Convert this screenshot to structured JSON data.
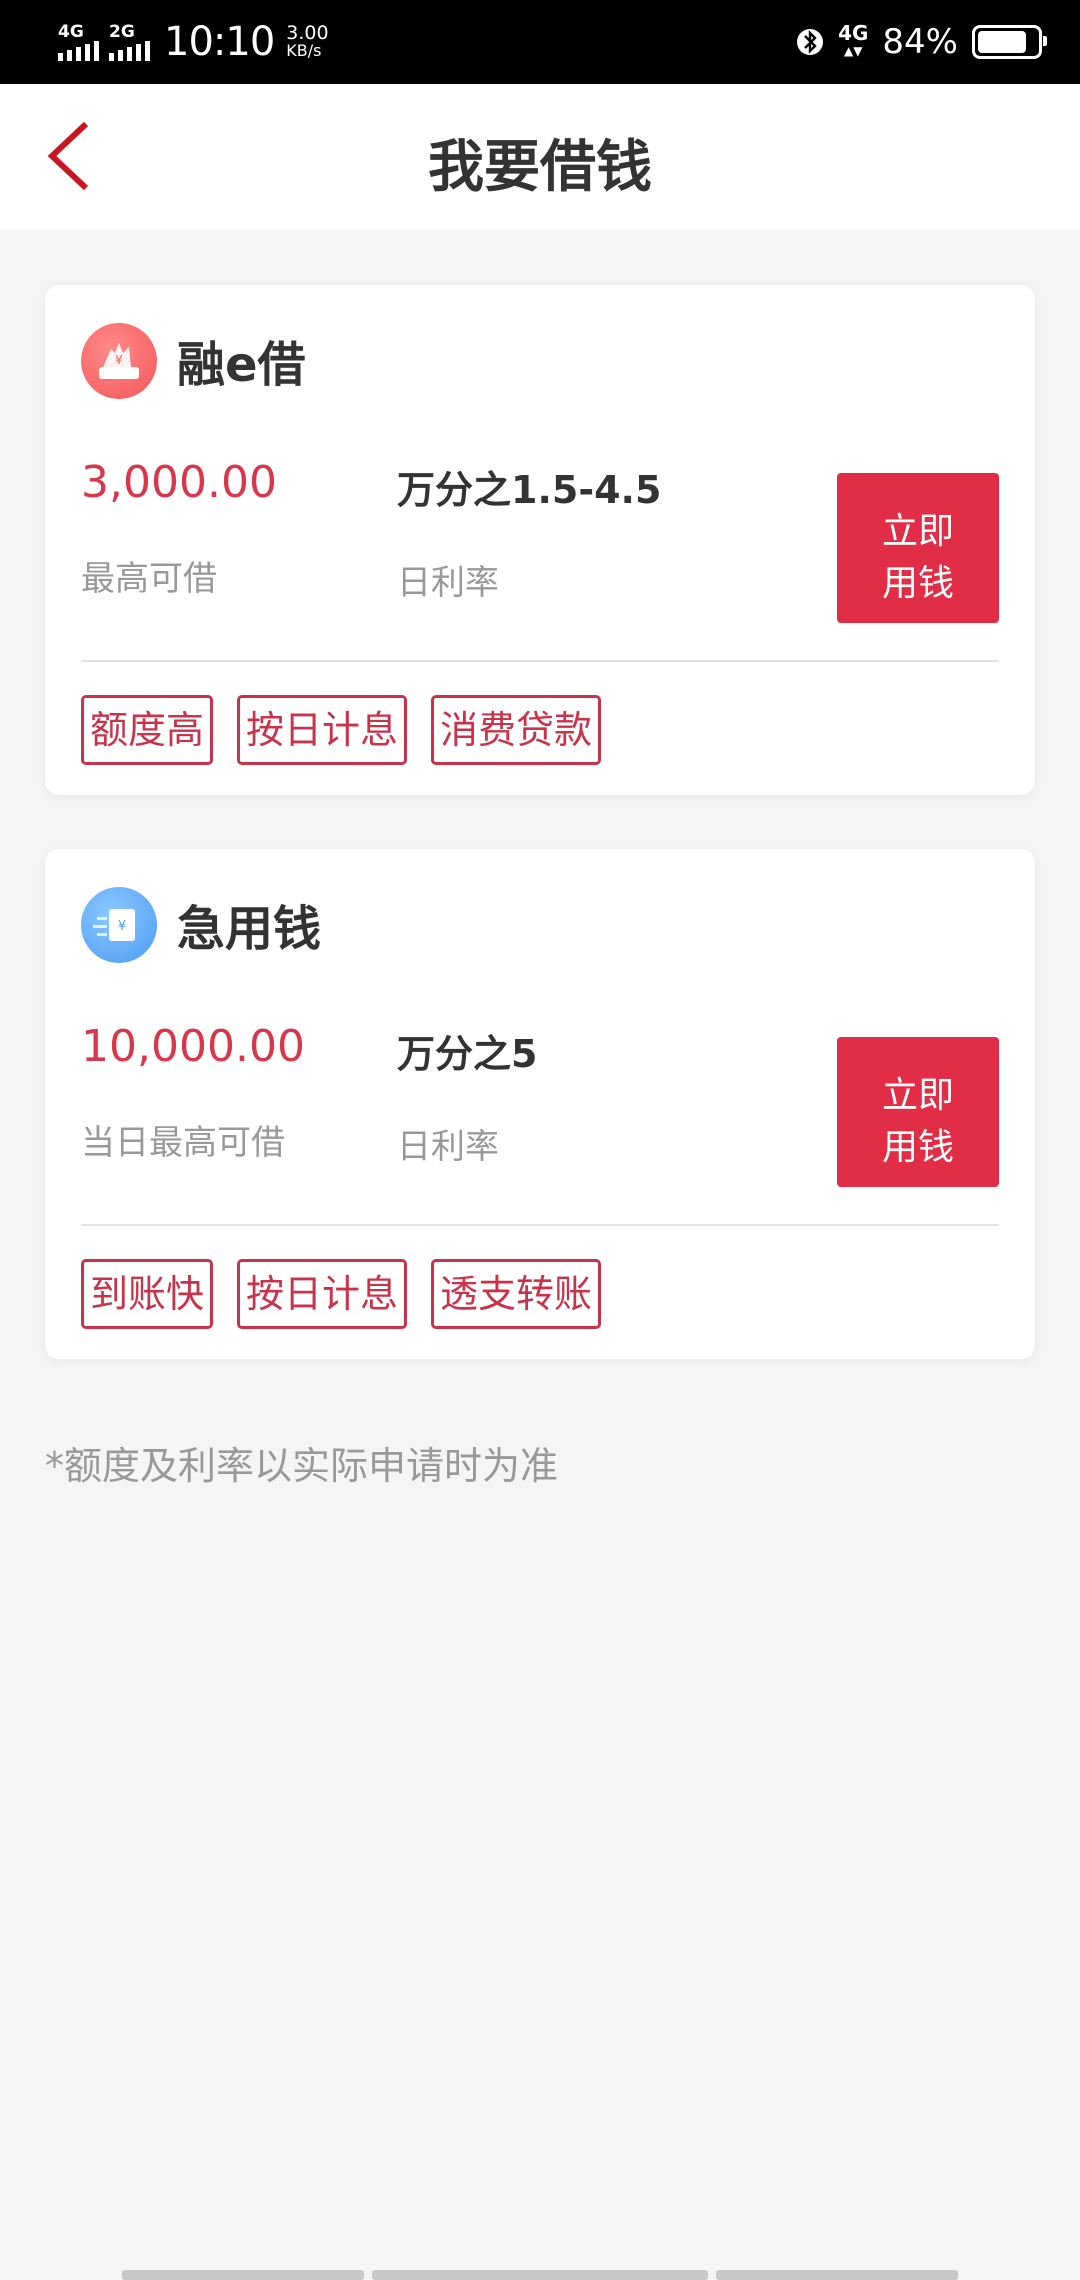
{
  "status_bar": {
    "network1": "4G",
    "network2": "2G",
    "time": "10:10",
    "speed_value": "3.00",
    "speed_unit": "KB/s",
    "network_right": "4G",
    "battery_percent": "84%",
    "battery_level": 0.84
  },
  "header": {
    "title": "我要借钱"
  },
  "products": [
    {
      "name": "融e借",
      "amount": "3,000.00",
      "amount_label": "最高可借",
      "rate": "万分之1.5-4.5",
      "rate_label": "日利率",
      "cta_line1": "立即",
      "cta_line2": "用钱",
      "tags": [
        "额度高",
        "按日计息",
        "消费贷款"
      ],
      "icon": "hand-money-icon"
    },
    {
      "name": "急用钱",
      "amount": "10,000.00",
      "amount_label": "当日最高可借",
      "rate": "万分之5",
      "rate_label": "日利率",
      "cta_line1": "立即",
      "cta_line2": "用钱",
      "tags": [
        "到账快",
        "按日计息",
        "透支转账"
      ],
      "icon": "fast-money-icon"
    }
  ],
  "note": "*额度及利率以实际申请时为准",
  "colors": {
    "accent": "#e22d46",
    "amount": "#d8364a",
    "tag": "#c9334a"
  }
}
